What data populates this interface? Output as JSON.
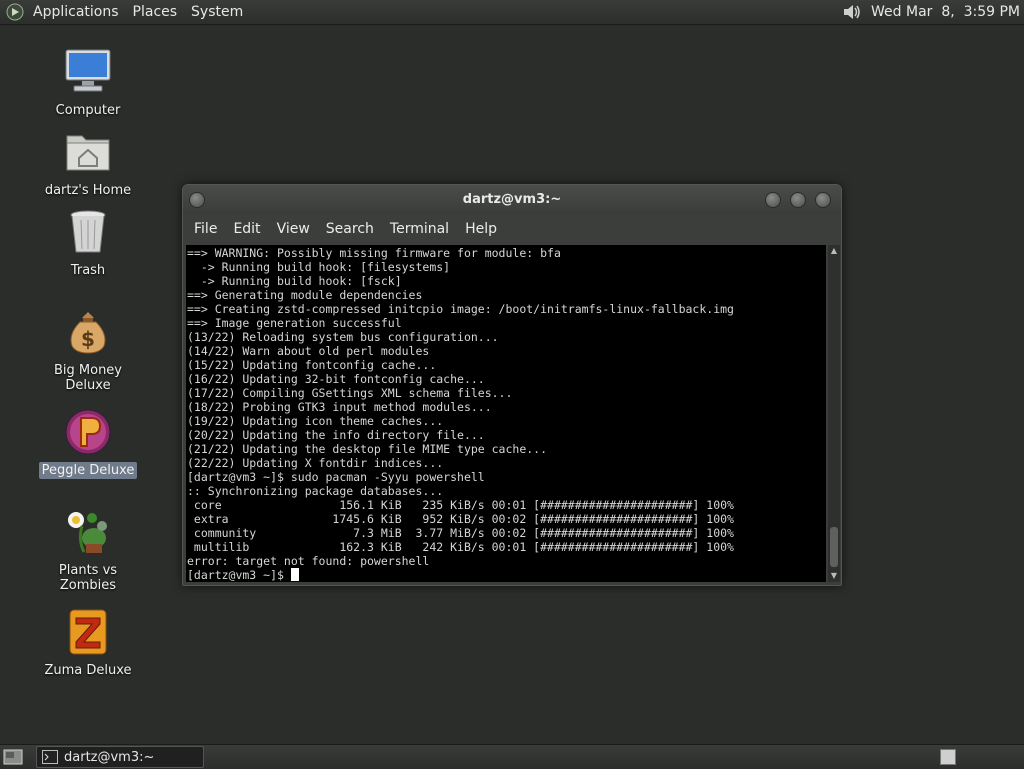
{
  "top_panel": {
    "menus": [
      "Applications",
      "Places",
      "System"
    ],
    "clock": "Wed Mar  8,  3:59 PM"
  },
  "desktop_icons": [
    {
      "label": "Computer"
    },
    {
      "label": "dartz's Home"
    },
    {
      "label": "Trash"
    },
    {
      "label": "Big Money Deluxe"
    },
    {
      "label": "Peggle Deluxe",
      "selected": true
    },
    {
      "label": "Plants vs Zombies"
    },
    {
      "label": "Zuma Deluxe"
    }
  ],
  "terminal": {
    "title": "dartz@vm3:~",
    "menu": [
      "File",
      "Edit",
      "View",
      "Search",
      "Terminal",
      "Help"
    ],
    "lines": [
      "==> WARNING: Possibly missing firmware for module: bfa",
      "  -> Running build hook: [filesystems]",
      "  -> Running build hook: [fsck]",
      "==> Generating module dependencies",
      "==> Creating zstd-compressed initcpio image: /boot/initramfs-linux-fallback.img",
      "==> Image generation successful",
      "(13/22) Reloading system bus configuration...",
      "(14/22) Warn about old perl modules",
      "(15/22) Updating fontconfig cache...",
      "(16/22) Updating 32-bit fontconfig cache...",
      "(17/22) Compiling GSettings XML schema files...",
      "(18/22) Probing GTK3 input method modules...",
      "(19/22) Updating icon theme caches...",
      "(20/22) Updating the info directory file...",
      "(21/22) Updating the desktop file MIME type cache...",
      "(22/22) Updating X fontdir indices...",
      "[dartz@vm3 ~]$ sudo pacman -Syyu powershell",
      ":: Synchronizing package databases...",
      " core                 156.1 KiB   235 KiB/s 00:01 [######################] 100%",
      " extra               1745.6 KiB   952 KiB/s 00:02 [######################] 100%",
      " community              7.3 MiB  3.77 MiB/s 00:02 [######################] 100%",
      " multilib             162.3 KiB   242 KiB/s 00:01 [######################] 100%",
      "error: target not found: powershell"
    ],
    "prompt": "[dartz@vm3 ~]$ "
  },
  "taskbar": {
    "task_label": "dartz@vm3:~"
  }
}
